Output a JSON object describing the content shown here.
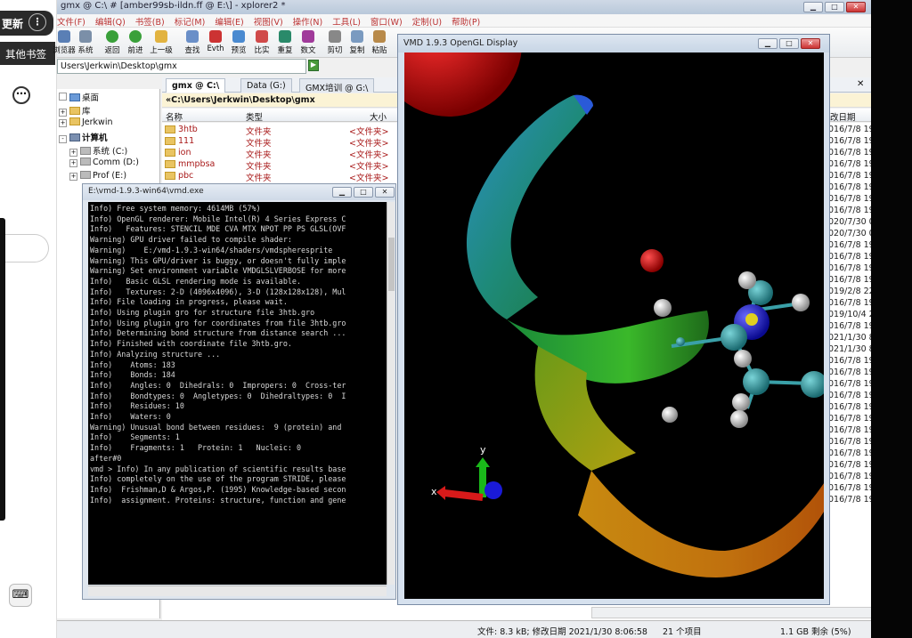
{
  "browser": {
    "update_label": "更新",
    "update_menu": "⋮",
    "bookmarks_label": "其他书签",
    "more_label": "⋯",
    "keyboard_icon": "⌨"
  },
  "xplorer": {
    "title": "gmx @ C:\\ # [amber99sb-ildn.ff @ E:\\] - xplorer2 *",
    "menu": [
      "文件(F)",
      "编辑(Q)",
      "书签(B)",
      "标记(M)",
      "编辑(E)",
      "视图(V)",
      "操作(N)",
      "工具(L)",
      "窗口(W)",
      "定制(U)",
      "帮助(P)"
    ],
    "toolbar": [
      "浏览器",
      "系统",
      "返回",
      "前进",
      "上一级",
      "查找",
      "Evth",
      "预览",
      "比实",
      "重复",
      "数文",
      "剪切",
      "复制",
      "粘贴"
    ],
    "address": "Users\\Jerkwin\\Desktop\\gmx",
    "tree": [
      {
        "label": "桌面",
        "expand": ""
      },
      {
        "label": "库",
        "expand": "+"
      },
      {
        "label": "Jerkwin",
        "expand": "+"
      },
      {
        "label": "计算机",
        "expand": "-"
      },
      {
        "label": "系统 (C:)",
        "expand": "+"
      },
      {
        "label": "Comm (D:)",
        "expand": "+"
      },
      {
        "label": "Prof (E:)",
        "expand": "+"
      }
    ],
    "tabs": [
      "gmx @ C:\\",
      "Data (G:)",
      "GMX培训 @ G:\\"
    ],
    "path": "«C:\\Users\\Jerkwin\\Desktop\\gmx",
    "columns": {
      "name": "名称",
      "type": "类型",
      "size": "大小",
      "modified": "改日期"
    },
    "files": [
      {
        "name": "3htb",
        "type": "文件夹",
        "size": "<文件夹>"
      },
      {
        "name": "111",
        "type": "文件夹",
        "size": "<文件夹>"
      },
      {
        "name": "ion",
        "type": "文件夹",
        "size": "<文件夹>"
      },
      {
        "name": "mmpbsa",
        "type": "文件夹",
        "size": "<文件夹>"
      },
      {
        "name": "pbc",
        "type": "文件夹",
        "size": "<文件夹>"
      }
    ],
    "dates": [
      "016/7/8 19",
      "016/7/8 19",
      "016/7/8 19",
      "016/7/8 19",
      "016/7/8 19",
      "016/7/8 19",
      "016/7/8 19",
      "016/7/8 19",
      "020/7/30 0",
      "020/7/30 0",
      "016/7/8 19",
      "016/7/8 19",
      "016/7/8 19",
      "016/7/8 19",
      "019/2/8 22",
      "016/7/8 19",
      "019/10/4 2",
      "016/7/8 19",
      "021/1/30 8",
      "021/1/30 8",
      "016/7/8 19",
      "016/7/8 19",
      "016/7/8 19",
      "016/7/8 19",
      "016/7/8 19",
      "016/7/8 19",
      "016/7/8 19",
      "016/7/8 19",
      "016/7/8 19",
      "016/7/8 19",
      "016/7/8 19",
      "016/7/8 19",
      "016/7/8 19"
    ],
    "status": {
      "info": "文件: 8.3 kB; 修改日期 2021/1/30 8:06:58",
      "count": "21 个项目",
      "free": "1.1 GB 剩余 (5%)"
    }
  },
  "console": {
    "title": "E:\\vmd-1.9.3-win64\\vmd.exe",
    "lines": [
      "Info) Free system memory: 4614MB (57%)",
      "Info) OpenGL renderer: Mobile Intel(R) 4 Series Express C",
      "Info)   Features: STENCIL MDE CVA MTX NPOT PP PS GLSL(OVF",
      "Warning) GPU driver failed to compile shader:",
      "Warning)    E:/vmd-1.9.3-win64/shaders/vmdspheresprite",
      "Warning) This GPU/driver is buggy, or doesn't fully imple",
      "Warning) Set environment variable VMDGLSLVERBOSE for more",
      "Info)   Basic GLSL rendering mode is available.",
      "Info)   Textures: 2-D (4096x4096), 3-D (128x128x128), Mul",
      "Info) File loading in progress, please wait.",
      "Info) Using plugin gro for structure file 3htb.gro",
      "Info) Using plugin gro for coordinates from file 3htb.gro",
      "Info) Determining bond structure from distance search ...",
      "Info) Finished with coordinate file 3htb.gro.",
      "Info) Analyzing structure ...",
      "Info)    Atoms: 183",
      "Info)    Bonds: 184",
      "Info)    Angles: 0  Dihedrals: 0  Impropers: 0  Cross-ter",
      "Info)    Bondtypes: 0  Angletypes: 0  Dihedraltypes: 0  I",
      "Info)    Residues: 10",
      "Info)    Waters: 0",
      "Warning) Unusual bond between residues:  9 (protein) and",
      "Info)    Segments: 1",
      "Info)    Fragments: 1   Protein: 1   Nucleic: 0",
      "after#0",
      "vmd > Info) In any publication of scientific results base",
      "Info) completely on the use of the program STRIDE, please",
      "Info)  Frishman,D & Argos,P. (1995) Knowledge-based secon",
      "Info)  assignment. Proteins: structure, function and gene"
    ]
  },
  "vmd": {
    "title": "VMD 1.9.3 OpenGL Display",
    "axis_x": "x",
    "axis_y": "y"
  },
  "window_controls": {
    "min": "▁",
    "max": "□",
    "close": "✕"
  }
}
